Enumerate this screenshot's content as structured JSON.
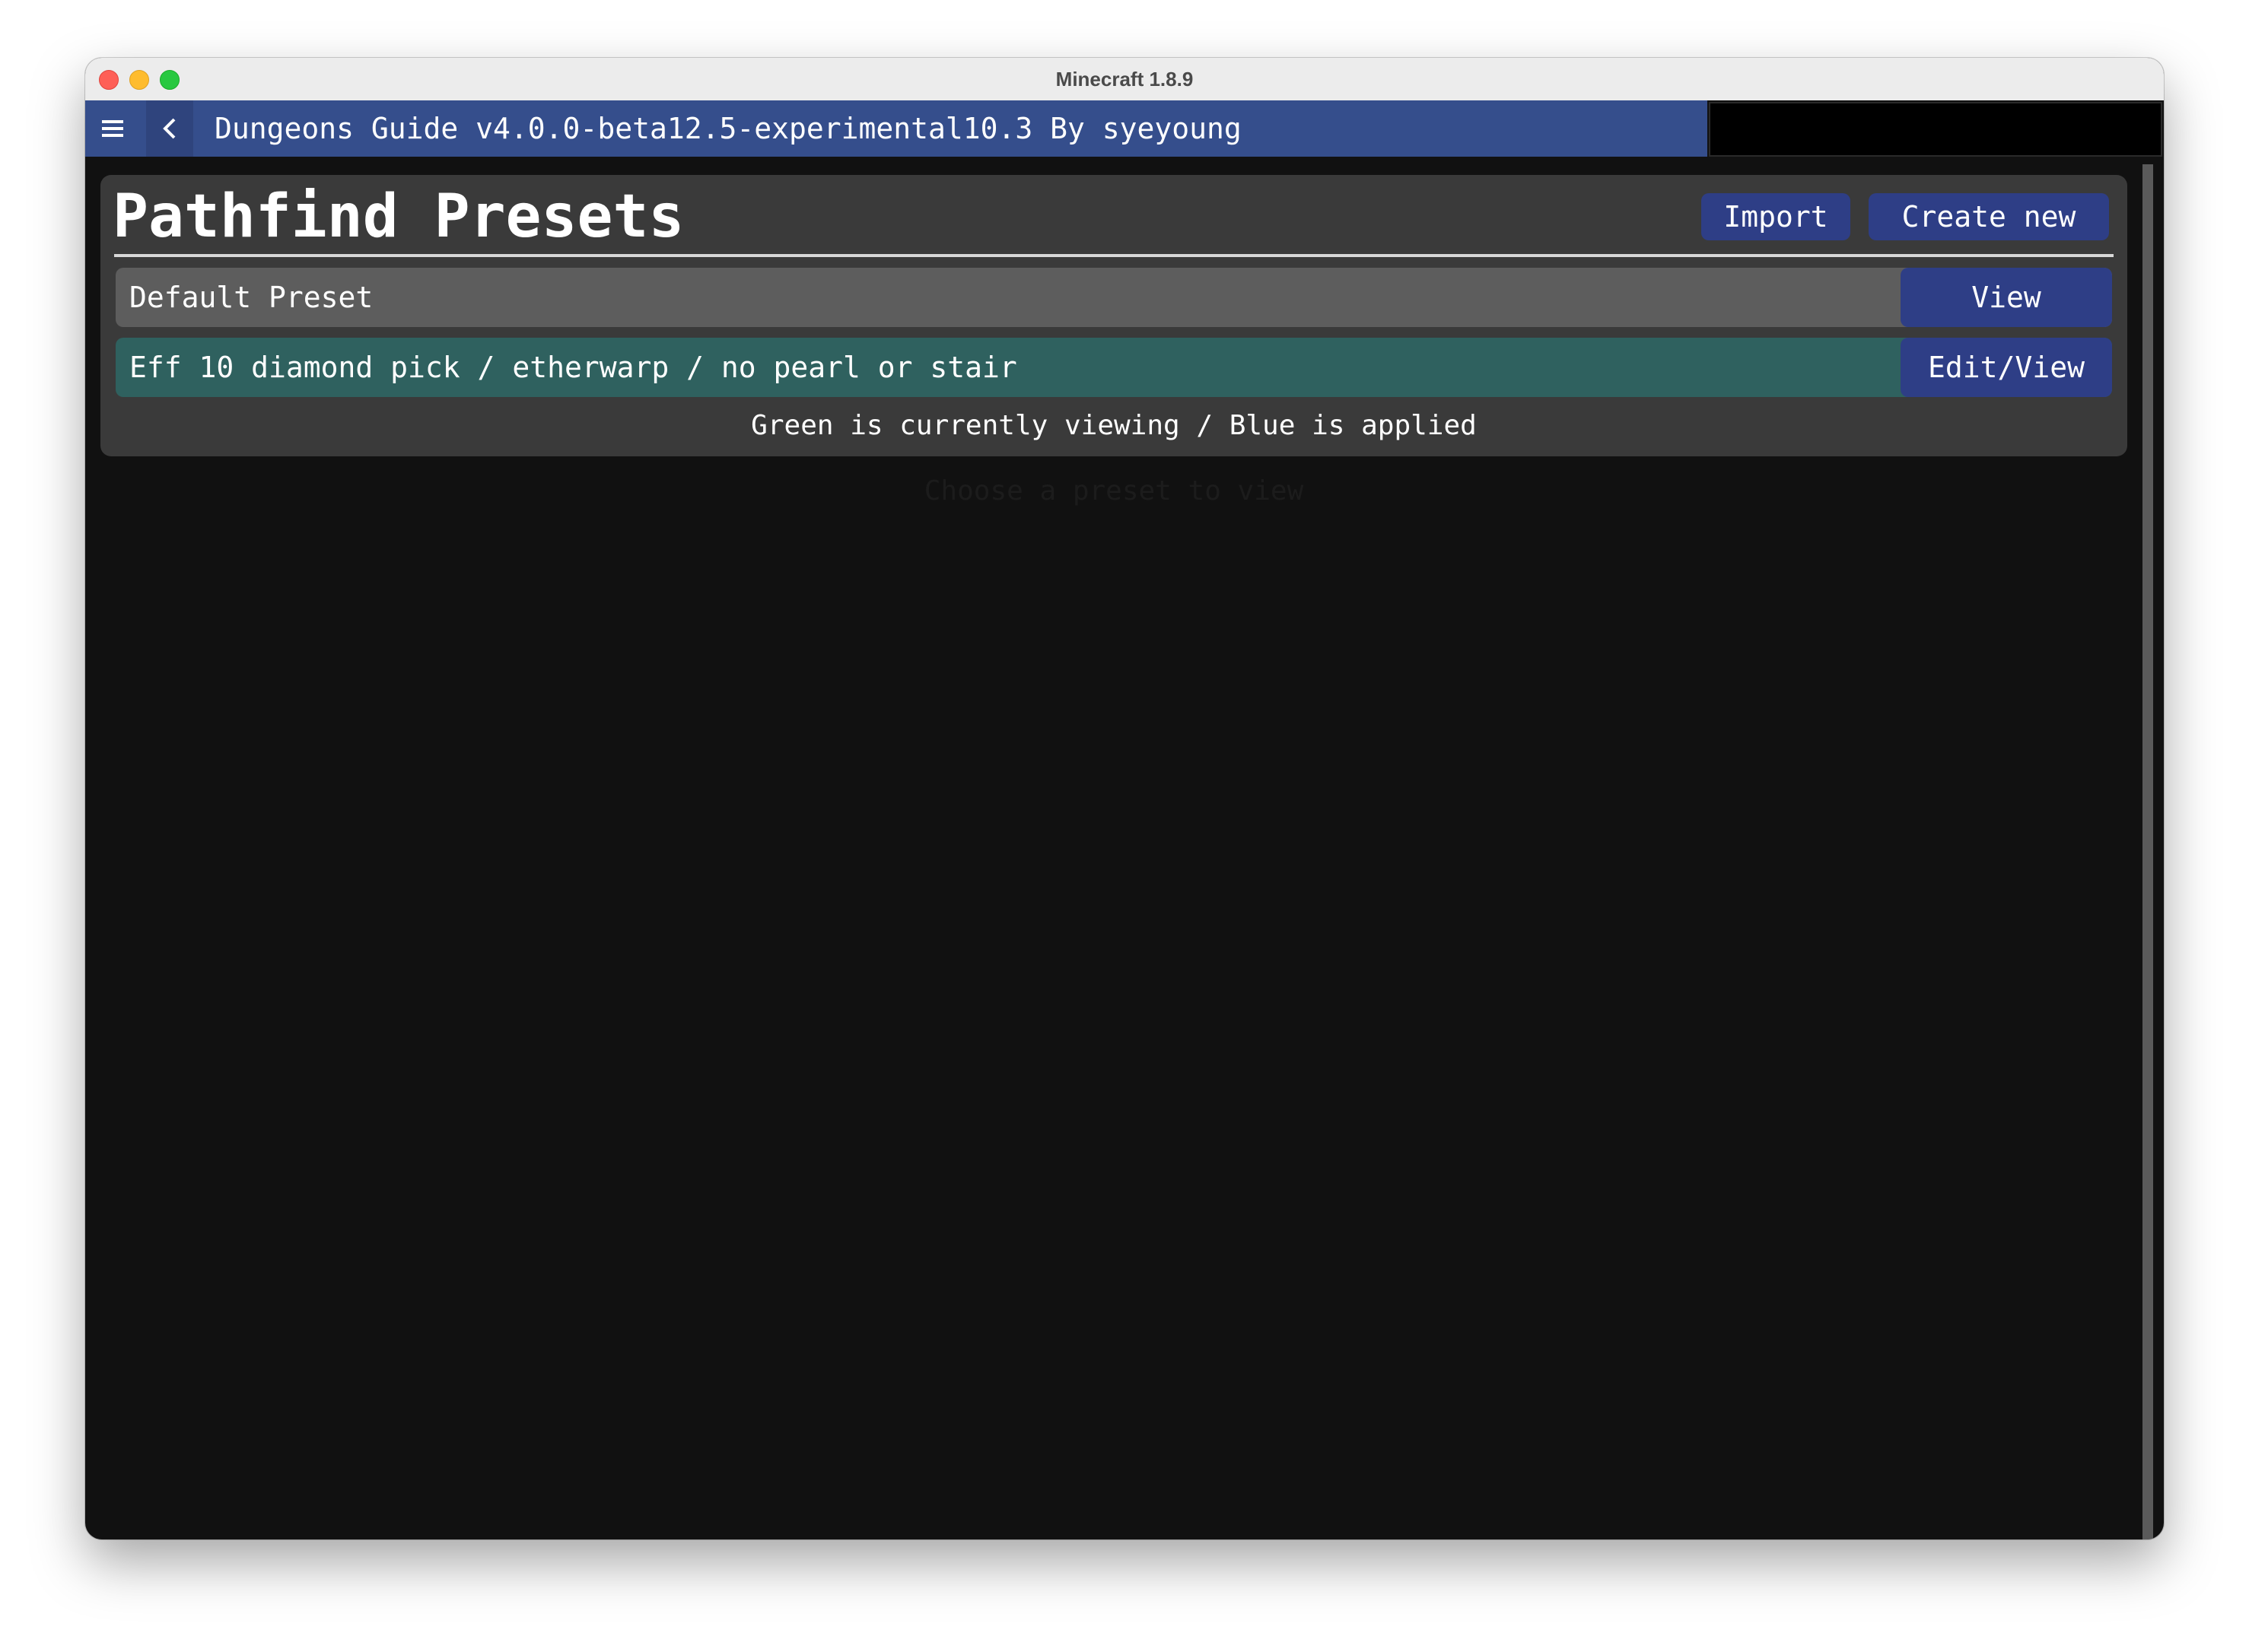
{
  "window": {
    "title": "Minecraft 1.8.9"
  },
  "appbar": {
    "title": "Dungeons Guide v4.0.0-beta12.5-experimental10.3 By syeyoung",
    "icons": [
      "menu-icon",
      "back-icon"
    ]
  },
  "panel": {
    "title": "Pathfind Presets",
    "import_label": "Import",
    "create_label": "Create new",
    "presets": [
      {
        "name": "Default Preset",
        "action": "View"
      },
      {
        "name": "Eff 10 diamond pick / etherwarp / no pearl or stair",
        "action": "Edit/View"
      }
    ],
    "legend": "Green is currently viewing / Blue is applied"
  },
  "empty_state": {
    "hint": "Choose a preset to view"
  },
  "colors": {
    "appbar_blue": "#354e8c",
    "button_blue": "#2e3e86",
    "row_default": "#5d5d5d",
    "row_viewing": "#2f615f",
    "panel": "#3a3a3a",
    "background": "#111111"
  }
}
